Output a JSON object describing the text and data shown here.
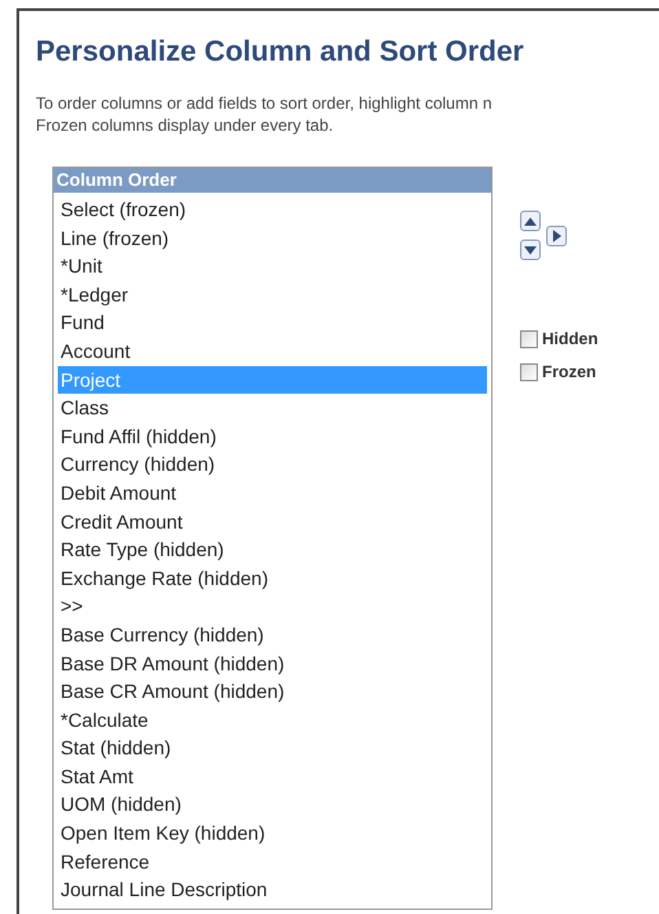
{
  "title": "Personalize Column and Sort Order",
  "instructions": [
    "To order columns or add fields to sort order, highlight column n",
    "Frozen columns display under every tab."
  ],
  "column_order": {
    "header": "Column Order",
    "items": [
      {
        "label": "Select (frozen)",
        "selected": false
      },
      {
        "label": "Line (frozen)",
        "selected": false
      },
      {
        "label": "*Unit",
        "selected": false
      },
      {
        "label": "*Ledger",
        "selected": false
      },
      {
        "label": "Fund",
        "selected": false
      },
      {
        "label": "Account",
        "selected": false
      },
      {
        "label": "Project",
        "selected": true
      },
      {
        "label": "Class",
        "selected": false
      },
      {
        "label": "Fund Affil (hidden)",
        "selected": false
      },
      {
        "label": "Currency (hidden)",
        "selected": false
      },
      {
        "label": "Debit Amount",
        "selected": false
      },
      {
        "label": "Credit Amount",
        "selected": false
      },
      {
        "label": "Rate Type (hidden)",
        "selected": false
      },
      {
        "label": "Exchange Rate (hidden)",
        "selected": false
      },
      {
        "label": ">>",
        "selected": false
      },
      {
        "label": "Base Currency (hidden)",
        "selected": false
      },
      {
        "label": "Base DR Amount (hidden)",
        "selected": false
      },
      {
        "label": "Base CR Amount (hidden)",
        "selected": false
      },
      {
        "label": "*Calculate",
        "selected": false
      },
      {
        "label": "Stat (hidden)",
        "selected": false
      },
      {
        "label": "Stat Amt",
        "selected": false
      },
      {
        "label": "UOM (hidden)",
        "selected": false
      },
      {
        "label": "Open Item Key (hidden)",
        "selected": false
      },
      {
        "label": "Reference",
        "selected": false
      },
      {
        "label": "Journal Line Description",
        "selected": false
      }
    ]
  },
  "options": [
    {
      "label": "Hidden",
      "checked": false
    },
    {
      "label": "Frozen",
      "checked": false
    }
  ]
}
